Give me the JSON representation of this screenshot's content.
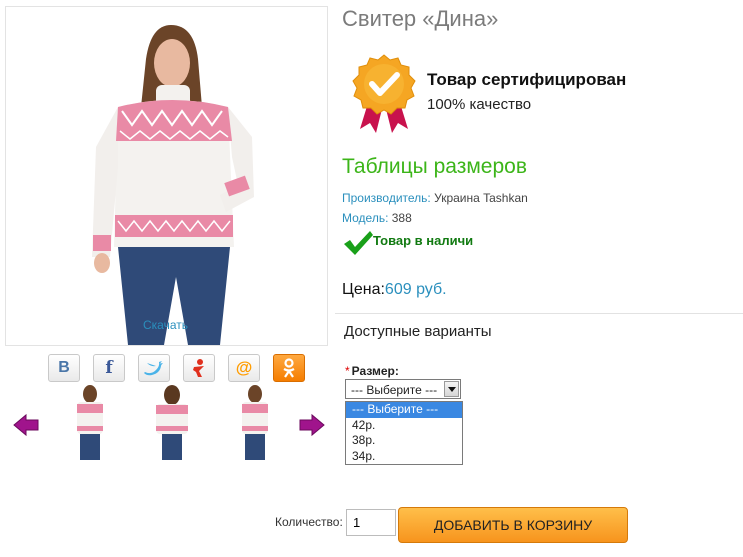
{
  "product": {
    "title": "Свитер «Дина»",
    "download_label": "Скачать"
  },
  "certificate": {
    "title": "Товар сертифицирован",
    "subtitle": "100% качество"
  },
  "size_table_link": "Таблицы размеров",
  "specs": {
    "manufacturer_label": "Производитель:",
    "manufacturer_value": "Украина Tashkan",
    "model_label": "Модель:",
    "model_value": "388"
  },
  "stock_status": "Товар в наличи",
  "price": {
    "label": "Цена:",
    "value": "609 руб."
  },
  "variants_title": "Доступные варианты",
  "size_option": {
    "label": "Размер:",
    "required_mark": "*",
    "selected": "--- Выберите ---",
    "options": [
      "--- Выберите ---",
      "42р.",
      "38р.",
      "34р."
    ]
  },
  "share_icons": [
    "vk-icon",
    "facebook-icon",
    "twitter-icon",
    "moimir-icon",
    "mailru-icon",
    "odnoklassniki-icon"
  ],
  "share_glyphs": {
    "vk": "В",
    "facebook": "f",
    "mailru": "@"
  },
  "quantity": {
    "label": "Количество:",
    "value": "1"
  },
  "add_to_cart_label": "ДОБАВИТЬ В КОРЗИНУ",
  "colors": {
    "accent_blue": "#2a8fbd",
    "link_green": "#3cb519",
    "stock_green": "#117a11",
    "button_orange": "#f7941d",
    "arrow_purple": "#a0148c"
  }
}
